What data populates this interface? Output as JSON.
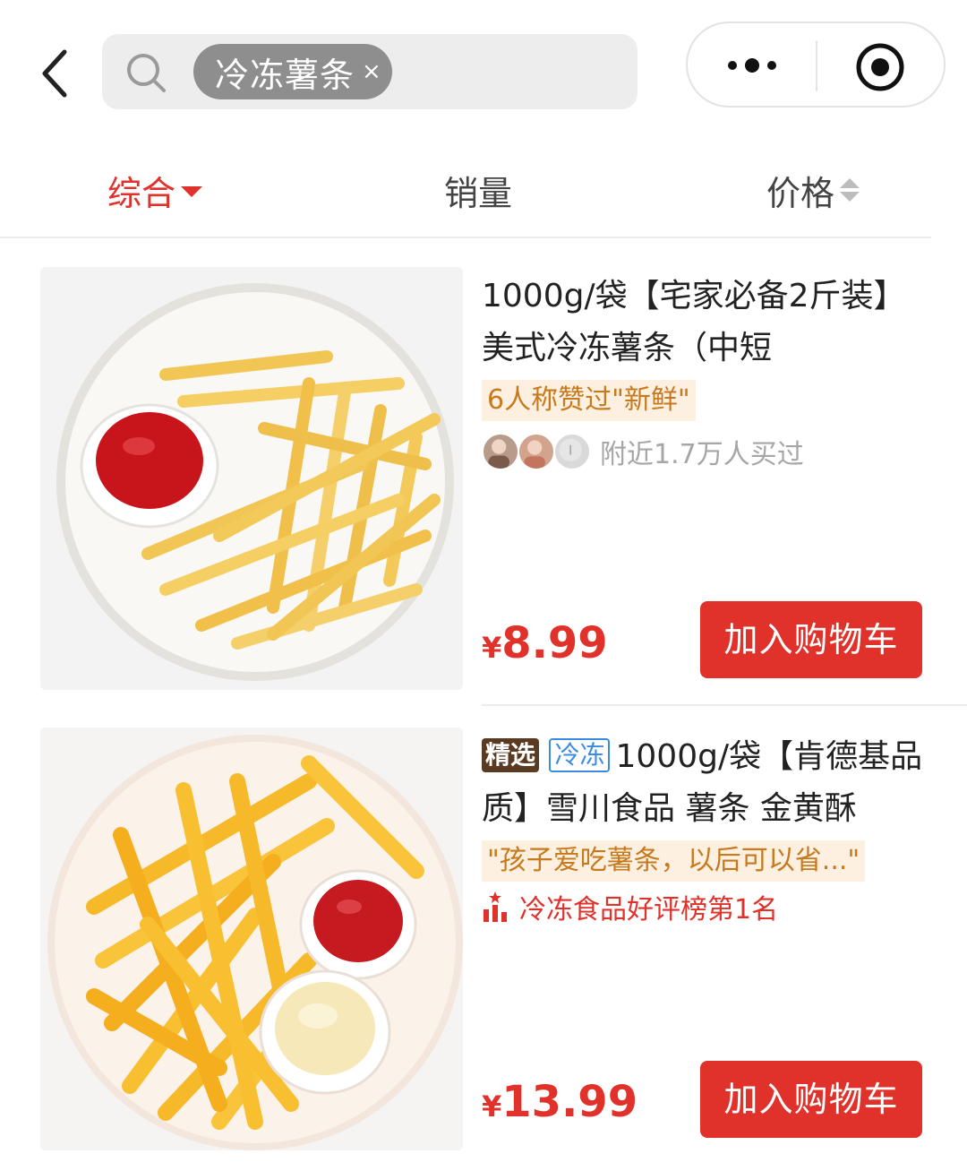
{
  "header": {
    "search_chip": "冷冻薯条",
    "chip_close": "×"
  },
  "sort": {
    "tabs": [
      {
        "label": "综合",
        "active": true
      },
      {
        "label": "销量",
        "active": false
      },
      {
        "label": "价格",
        "active": false
      }
    ]
  },
  "products": [
    {
      "title": "1000g/袋【宅家必备2斤装】美式冷冻薯条（中短",
      "praise": "6人称赞过\"新鲜\"",
      "buyers": "附近1.7万人买过",
      "price_symbol": "¥",
      "price": "8.99",
      "cart_label": "加入购物车"
    },
    {
      "tags": [
        "精选",
        "冷冻"
      ],
      "title": "1000g/袋【肯德基品质】雪川食品 薯条 金黄酥",
      "praise": "\"孩子爱吃薯条，以后可以省...\"",
      "rank": "冷冻食品好评榜第1名",
      "price_symbol": "¥",
      "price": "13.99",
      "cart_label": "加入购物车"
    }
  ],
  "colors": {
    "accent": "#e0322b",
    "praise_bg": "#fdf0e1",
    "praise_text": "#c77a1d",
    "tag_choice_bg": "#5b3a22",
    "tag_frozen": "#3b8be0"
  }
}
